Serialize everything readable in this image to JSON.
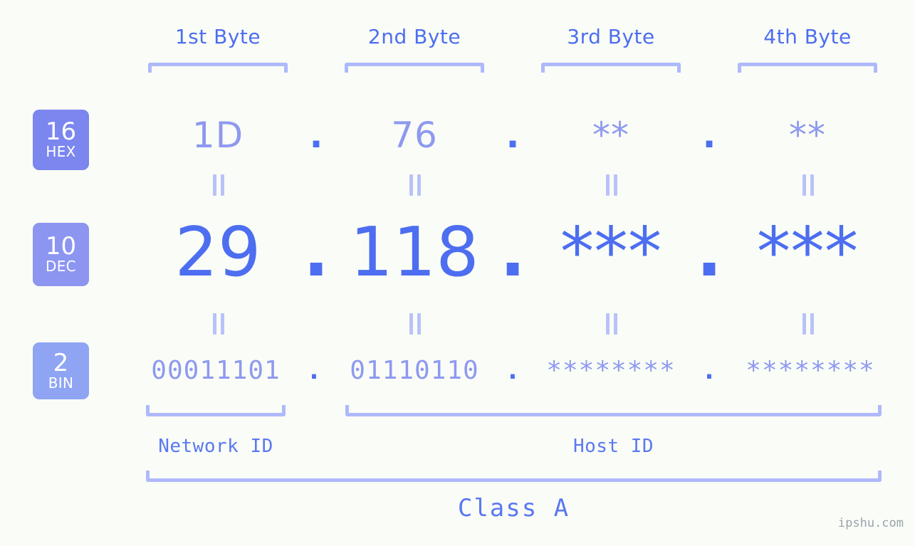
{
  "page": {
    "background_color": "#fafdf7",
    "accent_strong": "#4d6ef0",
    "accent_light": "#8e99ef",
    "bracket_color": "#aeb9fb"
  },
  "byte_headers": [
    {
      "label": "1st Byte"
    },
    {
      "label": "2nd Byte"
    },
    {
      "label": "3rd Byte"
    },
    {
      "label": "4th Byte"
    }
  ],
  "rows": [
    {
      "badge_num": "16",
      "badge_sub": "HEX",
      "badge_color": "#7b86ef",
      "values": [
        "1D",
        "76",
        "**",
        "**"
      ],
      "separator": "."
    },
    {
      "badge_num": "10",
      "badge_sub": "DEC",
      "badge_color": "#8c95f0",
      "values": [
        "29",
        "118",
        "***",
        "***"
      ],
      "separator": "."
    },
    {
      "badge_num": "2",
      "badge_sub": "BIN",
      "badge_color": "#8fa4f3",
      "values": [
        "00011101",
        "01110110",
        "********",
        "********"
      ],
      "separator": "."
    }
  ],
  "id_sections": [
    {
      "label": "Network ID"
    },
    {
      "label": "Host ID"
    }
  ],
  "class_label": "Class A",
  "watermark": "ipshu.com"
}
